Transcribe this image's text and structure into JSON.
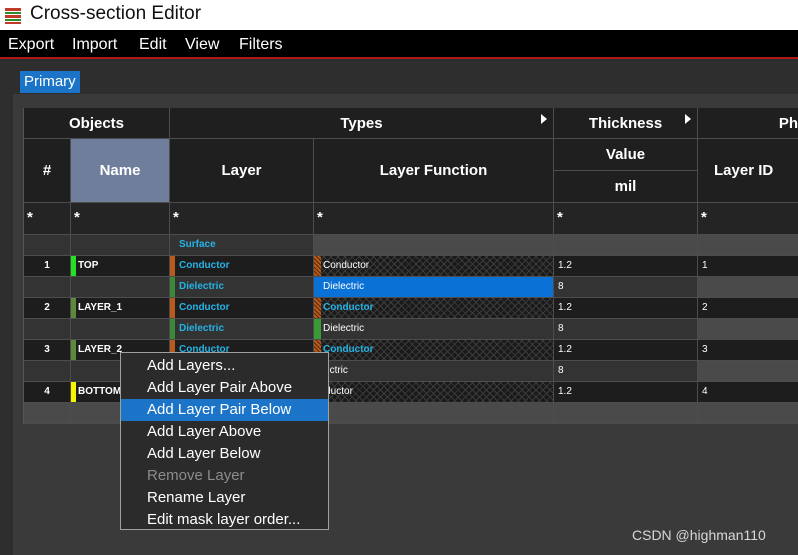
{
  "window": {
    "title": "Cross-section Editor",
    "icon": "layers-stack-icon"
  },
  "menu": [
    "Export",
    "Import",
    "Edit",
    "View",
    "Filters"
  ],
  "tabs": [
    {
      "label": "Primary",
      "active": true
    }
  ],
  "table": {
    "groups": {
      "objects": "Objects",
      "types": "Types",
      "thickness": "Thickness",
      "physical": "Ph"
    },
    "columns": {
      "num": "#",
      "name": "Name",
      "layer": "Layer",
      "layer_function": "Layer Function",
      "value": "Value",
      "unit": "mil",
      "layer_id": "Layer ID"
    },
    "filter": "*",
    "rows": [
      {
        "num": "",
        "name": "",
        "layer": "Surface",
        "function": "",
        "value": "",
        "id": ""
      },
      {
        "num": "1",
        "name": "TOP",
        "layer": "Conductor",
        "function": "Conductor",
        "value": "1.2",
        "id": "1"
      },
      {
        "num": "",
        "name": "",
        "layer": "Dielectric",
        "function": "Dielectric",
        "value": "8",
        "id": ""
      },
      {
        "num": "2",
        "name": "LAYER_1",
        "layer": "Conductor",
        "function": "Conductor",
        "value": "1.2",
        "id": "2"
      },
      {
        "num": "",
        "name": "",
        "layer": "Dielectric",
        "function": "Dielectric",
        "value": "8",
        "id": ""
      },
      {
        "num": "3",
        "name": "LAYER_2",
        "layer": "Conductor",
        "function": "Conductor",
        "value": "1.2",
        "id": "3"
      },
      {
        "num": "",
        "name": "",
        "layer": "",
        "function": "ielectric",
        "value": "8",
        "id": ""
      },
      {
        "num": "4",
        "name": "BOTTOM",
        "layer": "",
        "function": "onductor",
        "value": "1.2",
        "id": "4"
      }
    ],
    "colors": {
      "top": "#25e025",
      "layer1": "#5a8a3a",
      "layer2": "#5a8a3a",
      "bottom": "#f5f500",
      "conductor": "#b85a1e",
      "dielectric": "#3a8a3a",
      "selection": "#0a72d6"
    }
  },
  "context_menu": {
    "items": [
      {
        "label": "Add Layers...",
        "state": "normal"
      },
      {
        "label": "Add Layer Pair Above",
        "state": "normal"
      },
      {
        "label": "Add Layer Pair Below",
        "state": "highlighted"
      },
      {
        "label": "Add Layer Above",
        "state": "normal"
      },
      {
        "label": "Add Layer Below",
        "state": "normal"
      },
      {
        "label": "Remove Layer",
        "state": "disabled"
      },
      {
        "label": "Rename Layer",
        "state": "normal"
      },
      {
        "label": "Edit mask layer order...",
        "state": "normal"
      }
    ]
  },
  "watermark": "CSDN @highman110"
}
